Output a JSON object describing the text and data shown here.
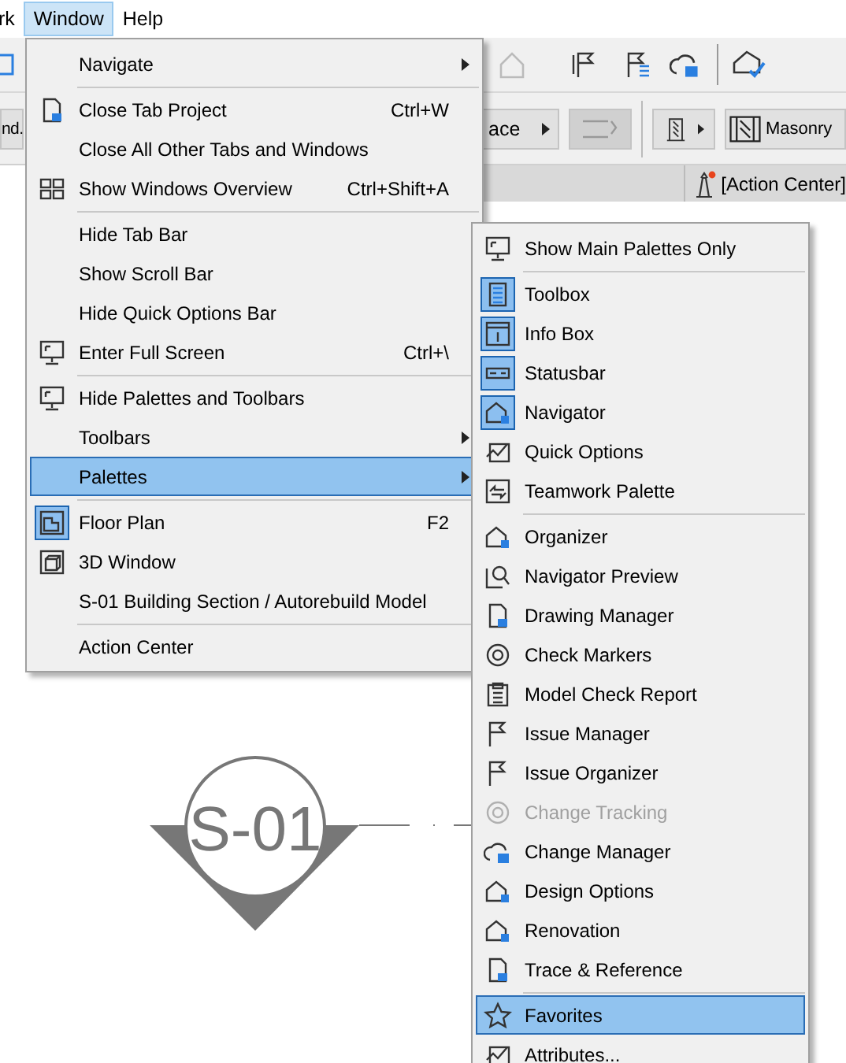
{
  "menubar": [
    {
      "label": "rk",
      "selected": false
    },
    {
      "label": "Window",
      "selected": true
    },
    {
      "label": "Help",
      "selected": false
    }
  ],
  "toolbar": {
    "left_button": "nd.",
    "face_button": "ace",
    "wall_button": "Masonry",
    "status_label": "[Action Center]"
  },
  "window_menu": [
    {
      "kind": "item",
      "label": "Navigate",
      "submenu": true,
      "selected": false,
      "checked": false
    },
    {
      "kind": "separator"
    },
    {
      "kind": "item",
      "label": "Close Tab Project",
      "shortcut": "Ctrl+W",
      "selected": false,
      "checked": false
    },
    {
      "kind": "item",
      "label": "Close All Other Tabs and Windows",
      "selected": false,
      "checked": false
    },
    {
      "kind": "item",
      "label": "Show Windows Overview",
      "shortcut": "Ctrl+Shift+A",
      "selected": false,
      "checked": false
    },
    {
      "kind": "separator"
    },
    {
      "kind": "item",
      "label": "Hide Tab Bar",
      "selected": false,
      "checked": false
    },
    {
      "kind": "item",
      "label": "Show Scroll Bar",
      "selected": false,
      "checked": false
    },
    {
      "kind": "item",
      "label": "Hide Quick Options Bar",
      "selected": false,
      "checked": false
    },
    {
      "kind": "item",
      "label": "Enter Full Screen",
      "shortcut": "Ctrl+\\",
      "selected": false,
      "checked": false
    },
    {
      "kind": "separator"
    },
    {
      "kind": "item",
      "label": "Hide Palettes and Toolbars",
      "selected": false,
      "checked": false
    },
    {
      "kind": "item",
      "label": "Toolbars",
      "submenu": true,
      "selected": false,
      "checked": false
    },
    {
      "kind": "item",
      "label": "Palettes",
      "submenu": true,
      "selected": true,
      "checked": false
    },
    {
      "kind": "separator"
    },
    {
      "kind": "item",
      "label": "Floor Plan",
      "shortcut": "F2",
      "selected": false,
      "checked": true
    },
    {
      "kind": "item",
      "label": "3D Window",
      "selected": false,
      "checked": false
    },
    {
      "kind": "item",
      "label": "S-01 Building Section / Autorebuild Model",
      "selected": false,
      "checked": false
    },
    {
      "kind": "separator"
    },
    {
      "kind": "item",
      "label": "Action Center",
      "selected": false,
      "checked": false
    }
  ],
  "palettes_menu": [
    {
      "kind": "item",
      "label": "Show Main Palettes Only",
      "selected": false,
      "checked": false,
      "disabled": false
    },
    {
      "kind": "separator"
    },
    {
      "kind": "item",
      "label": "Toolbox",
      "selected": false,
      "checked": true,
      "disabled": false
    },
    {
      "kind": "item",
      "label": "Info Box",
      "selected": false,
      "checked": true,
      "disabled": false
    },
    {
      "kind": "item",
      "label": "Statusbar",
      "selected": false,
      "checked": true,
      "disabled": false
    },
    {
      "kind": "item",
      "label": "Navigator",
      "selected": false,
      "checked": true,
      "disabled": false
    },
    {
      "kind": "item",
      "label": "Quick Options",
      "selected": false,
      "checked": false,
      "disabled": false
    },
    {
      "kind": "item",
      "label": "Teamwork Palette",
      "selected": false,
      "checked": false,
      "disabled": false
    },
    {
      "kind": "separator"
    },
    {
      "kind": "item",
      "label": "Organizer",
      "selected": false,
      "checked": false,
      "disabled": false
    },
    {
      "kind": "item",
      "label": "Navigator Preview",
      "selected": false,
      "checked": false,
      "disabled": false
    },
    {
      "kind": "item",
      "label": "Drawing Manager",
      "selected": false,
      "checked": false,
      "disabled": false
    },
    {
      "kind": "item",
      "label": "Check Markers",
      "selected": false,
      "checked": false,
      "disabled": false
    },
    {
      "kind": "item",
      "label": "Model Check Report",
      "selected": false,
      "checked": false,
      "disabled": false
    },
    {
      "kind": "item",
      "label": "Issue Manager",
      "selected": false,
      "checked": false,
      "disabled": false
    },
    {
      "kind": "item",
      "label": "Issue Organizer",
      "selected": false,
      "checked": false,
      "disabled": false
    },
    {
      "kind": "item",
      "label": "Change Tracking",
      "selected": false,
      "checked": false,
      "disabled": true
    },
    {
      "kind": "item",
      "label": "Change Manager",
      "selected": false,
      "checked": false,
      "disabled": false
    },
    {
      "kind": "item",
      "label": "Design Options",
      "selected": false,
      "checked": false,
      "disabled": false
    },
    {
      "kind": "item",
      "label": "Renovation",
      "selected": false,
      "checked": false,
      "disabled": false
    },
    {
      "kind": "item",
      "label": "Trace & Reference",
      "selected": false,
      "checked": false,
      "disabled": false
    },
    {
      "kind": "separator"
    },
    {
      "kind": "item",
      "label": "Favorites",
      "selected": true,
      "checked": false,
      "disabled": false
    },
    {
      "kind": "item",
      "label": "Attributes...",
      "selected": false,
      "checked": false,
      "disabled": false
    }
  ],
  "canvas": {
    "section_label": "S-01"
  }
}
